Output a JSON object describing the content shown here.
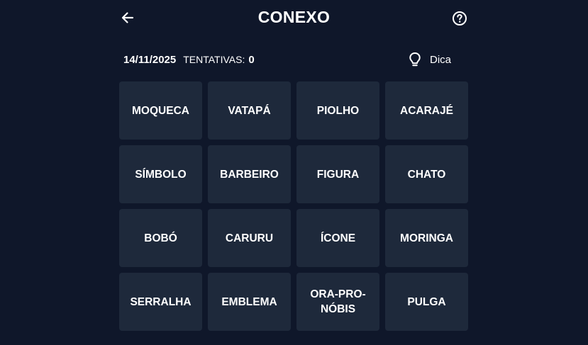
{
  "header": {
    "title": "CONEXO",
    "back_icon": "arrow-left-icon",
    "help_icon": "help-circle-icon"
  },
  "info": {
    "date": "14/11/2025",
    "attempts_label": "TENTATIVAS:",
    "attempts_value": "0",
    "hint_label": "Dica",
    "hint_icon": "lightbulb-icon"
  },
  "colors": {
    "background": "#0f172a",
    "tile": "#1e293b",
    "text": "#ffffff"
  },
  "tiles": [
    "MOQUECA",
    "VATAPÁ",
    "PIOLHO",
    "ACARAJÉ",
    "SÍMBOLO",
    "BARBEIRO",
    "FIGURA",
    "CHATO",
    "BOBÓ",
    "CARURU",
    "ÍCONE",
    "MORINGA",
    "SERRALHA",
    "EMBLEMA",
    "ORA-PRO-NÓBIS",
    "PULGA"
  ]
}
